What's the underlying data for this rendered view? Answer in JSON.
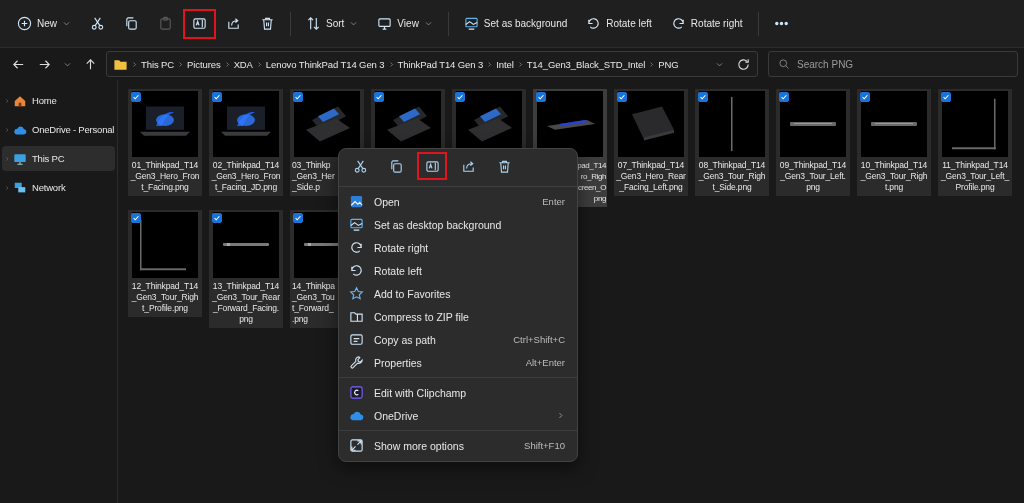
{
  "toolbar": {
    "groups": [
      [
        {
          "label": "New",
          "caret": true,
          "disabled": false,
          "highlighted": false
        },
        {
          "caret": false,
          "disabled": false,
          "highlighted": false
        },
        {
          "caret": false,
          "disabled": false,
          "highlighted": false
        },
        {
          "caret": false,
          "disabled": true,
          "highlighted": false
        },
        {
          "caret": false,
          "disabled": false,
          "highlighted": true
        },
        {
          "caret": false,
          "disabled": false,
          "highlighted": false
        },
        {
          "caret": false,
          "disabled": false,
          "highlighted": false
        }
      ],
      [
        {
          "label": "Sort",
          "caret": true,
          "disabled": false,
          "highlighted": false
        },
        {
          "label": "View",
          "caret": true,
          "disabled": false,
          "highlighted": false
        }
      ],
      [
        {
          "label": "Set as background",
          "caret": false,
          "disabled": false,
          "highlighted": false
        },
        {
          "label": "Rotate left",
          "caret": false,
          "disabled": false,
          "highlighted": false
        },
        {
          "label": "Rotate right",
          "caret": false,
          "disabled": false,
          "highlighted": false
        }
      ],
      [
        {
          "caret": false,
          "disabled": false,
          "highlighted": false
        }
      ]
    ]
  },
  "breadcrumb": [
    "This PC",
    "Pictures",
    "XDA",
    "Lenovo ThinkPad T14 Gen 3",
    "ThinkPad T14 Gen 3",
    "Intel",
    "T14_Gen3_Black_STD_Intel",
    "PNG"
  ],
  "search": {
    "placeholder": "Search PNG"
  },
  "sidebar": {
    "items": [
      {
        "label": "Home",
        "selected": false
      },
      {
        "label": "OneDrive - Personal",
        "selected": false
      },
      {
        "label": "This PC",
        "selected": true
      },
      {
        "label": "Network",
        "selected": false
      }
    ]
  },
  "tiles": [
    {
      "lines": [
        "01_Thinkpad_T14",
        "_Gen3_Hero_Fron",
        "t_Facing.png"
      ],
      "clipped_left": false,
      "clipped_right": false,
      "checked": true,
      "hovered": false
    },
    {
      "lines": [
        "02_Thinkpad_T14",
        "_Gen3_Hero_Fron",
        "t_Facing_JD.png"
      ],
      "clipped_left": false,
      "clipped_right": false,
      "checked": true,
      "hovered": false
    },
    {
      "lines": [
        "03_Thinkp",
        "_Gen3_Her",
        "_Side.p"
      ],
      "clipped_left": false,
      "clipped_right": true,
      "checked": true,
      "hovered": false
    },
    {
      "checked": true,
      "hovered": false
    },
    {
      "checked": true,
      "hovered": false
    },
    {
      "lines": [
        "pad_T14",
        "ro_Righ",
        "creen_O",
        "png"
      ],
      "clipped_left": true,
      "clipped_right": false,
      "checked": true,
      "hovered": true
    },
    {
      "lines": [
        "07_Thinkpad_T14",
        "_Gen3_Hero_Rear",
        "_Facing_Left.png"
      ],
      "clipped_left": false,
      "clipped_right": false,
      "checked": true,
      "hovered": false
    },
    {
      "lines": [
        "08_Thinkpad_T14",
        "_Gen3_Tour_Righ",
        "t_Side.png"
      ],
      "clipped_left": false,
      "clipped_right": false,
      "checked": true,
      "hovered": false
    },
    {
      "lines": [
        "09_Thinkpad_T14",
        "_Gen3_Tour_Left.",
        "png"
      ],
      "clipped_left": false,
      "clipped_right": false,
      "checked": true,
      "hovered": false
    },
    {
      "lines": [
        "10_Thinkpad_T14",
        "_Gen3_Tour_Righ",
        "t.png"
      ],
      "clipped_left": false,
      "clipped_right": false,
      "checked": true,
      "hovered": false
    },
    {
      "lines": [
        "11_Thinkpad_T14",
        "_Gen3_Tour_Left_",
        "Profile.png"
      ],
      "clipped_left": false,
      "clipped_right": false,
      "checked": true,
      "hovered": false
    },
    {
      "lines": [
        "12_Thinkpad_T14",
        "_Gen3_Tour_Righ",
        "t_Profile.png"
      ],
      "clipped_left": false,
      "clipped_right": false,
      "checked": true,
      "hovered": false
    },
    {
      "lines": [
        "13_Thinkpad_T14",
        "_Gen3_Tour_Rear",
        "_Forward_Facing.",
        "png"
      ],
      "clipped_left": false,
      "clipped_right": false,
      "checked": true,
      "hovered": false
    },
    {
      "lines": [
        "14_Thinkpa",
        "_Gen3_Tou",
        "t_Forward_",
        ".png"
      ],
      "clipped_left": false,
      "clipped_right": true,
      "checked": true,
      "hovered": false
    }
  ],
  "context_menu": {
    "actions": [
      {
        "highlighted": false
      },
      {
        "highlighted": false
      },
      {
        "highlighted": true
      },
      {
        "highlighted": false
      },
      {
        "highlighted": false
      }
    ],
    "groups": [
      [
        {
          "label": "Open",
          "shortcut": "Enter"
        },
        {
          "label": "Set as desktop background"
        },
        {
          "label": "Rotate right"
        },
        {
          "label": "Rotate left"
        },
        {
          "label": "Add to Favorites"
        },
        {
          "label": "Compress to ZIP file"
        },
        {
          "label": "Copy as path",
          "shortcut": "Ctrl+Shift+C"
        },
        {
          "label": "Properties",
          "shortcut": "Alt+Enter"
        }
      ],
      [
        {
          "label": "Edit with Clipchamp"
        },
        {
          "label": "OneDrive",
          "submenu": true
        }
      ],
      [
        {
          "label": "Show more options",
          "shortcut": "Shift+F10"
        }
      ]
    ]
  }
}
